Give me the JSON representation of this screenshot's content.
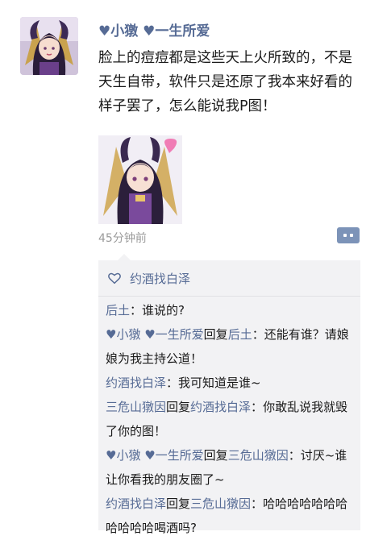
{
  "post": {
    "nickname": "♥小獤 ♥一生所爱",
    "text": "脸上的痘痘都是这些天上火所致的，不是天生自带，软件只是还原了我本来好看的样子罢了，怎么能说我P图！",
    "time": "45分钟前"
  },
  "likes": {
    "icon": "heart-outline-icon",
    "names": "约酒找白泽"
  },
  "comments": [
    {
      "from": "后土",
      "reply_word": "",
      "to": "",
      "text": "谁说的?"
    },
    {
      "from": "♥小獤 ♥一生所爱",
      "reply_word": "回复",
      "to": "后土",
      "text": "还能有谁？请娘娘为我主持公道！"
    },
    {
      "from": "约酒找白泽",
      "reply_word": "",
      "to": "",
      "text": "我可知道是谁~"
    },
    {
      "from": "三危山獤因",
      "reply_word": "回复",
      "to": "约酒找白泽",
      "text": "你敢乱说我就毁了你的图！"
    },
    {
      "from": "♥小獤 ♥一生所爱",
      "reply_word": "回复",
      "to": "三危山獤因",
      "text": "讨厌~谁让你看我的朋友圈了~"
    },
    {
      "from": "约酒找白泽",
      "reply_word": "回复",
      "to": "三危山獤因",
      "text": "哈哈哈哈哈哈哈哈哈哈哈喝酒吗?"
    }
  ],
  "colors": {
    "name": "#566b95",
    "comments_bg": "#f2f2f4",
    "more_button": "#7c93b8"
  }
}
